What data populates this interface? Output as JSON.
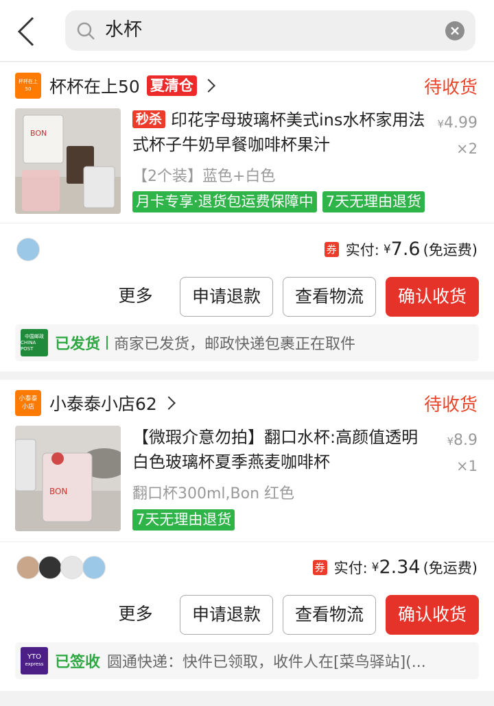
{
  "search": {
    "query": "水杯"
  },
  "orders": [
    {
      "shop": {
        "logo_text_1": "杯杯在上",
        "logo_text_2": "50",
        "name": "杯杯在上50",
        "promo_tag": "夏清仓"
      },
      "status": "待收货",
      "item": {
        "flash_tag": "秒杀",
        "title": "印花字母玻璃杯美式ins水杯家用法式杯子牛奶早餐咖啡杯果汁",
        "spec": "【2个装】蓝色+白色",
        "tags": [
          "月卡专享·退货包运费保障中",
          "7天无理由退货"
        ],
        "currency": "¥",
        "price": "4.99",
        "qty": "×2"
      },
      "payment": {
        "coupon": "券",
        "label": "实付:",
        "currency": "¥",
        "amount": "7.6",
        "shipping": "(免运费)"
      },
      "buttons": {
        "more": "更多",
        "refund": "申请退款",
        "logistics": "查看物流",
        "confirm": "确认收货"
      },
      "logistics": {
        "logo_text_1": "中国邮政",
        "logo_text_2": "CHINA POST",
        "status": "已发货",
        "text": "商家已发货，邮政快递包裹正在取件"
      }
    },
    {
      "shop": {
        "logo_text_1": "小泰泰",
        "logo_text_2": "小店",
        "name": "小泰泰小店62",
        "promo_tag": ""
      },
      "status": "待收货",
      "item": {
        "flash_tag": "",
        "title": "【微瑕介意勿拍】翻口水杯:高颜值透明白色玻璃杯夏季燕麦咖啡杯",
        "spec": "翻口杯300ml,Bon 红色",
        "tags": [
          "7天无理由退货"
        ],
        "currency": "¥",
        "price": "8.9",
        "qty": "×1"
      },
      "payment": {
        "coupon": "券",
        "label": "实付:",
        "currency": "¥",
        "amount": "2.34",
        "shipping": "(免运费)"
      },
      "buttons": {
        "more": "更多",
        "refund": "申请退款",
        "logistics": "查看物流",
        "confirm": "确认收货"
      },
      "logistics": {
        "logo_text_1": "YTO",
        "logo_text_2": "express",
        "status": "已签收",
        "text": "圆通快递：快件已领取，收件人在[菜鸟驿站](..."
      }
    }
  ],
  "colors": {
    "accent": "#e5332a",
    "status": "#e8462b",
    "green": "#2fb44a"
  }
}
